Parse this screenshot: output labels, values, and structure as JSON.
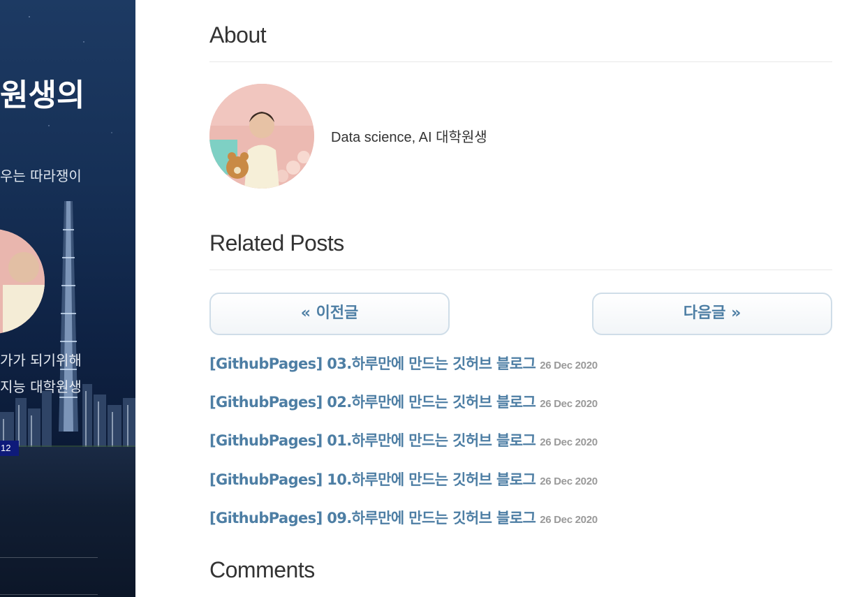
{
  "sidebar": {
    "title": "원생의",
    "subtitle": "우는 따라쟁이",
    "desc_line1": "가가 되기위해",
    "desc_line2": "지능 대학원생",
    "badge": "12"
  },
  "about": {
    "heading": "About",
    "text": "Data science, AI 대학원생"
  },
  "related": {
    "heading": "Related Posts",
    "prev_label": "« 이전글",
    "next_label": "다음글 »",
    "posts": [
      {
        "title": "[GithubPages] 03.하루만에 만드는 깃허브 블로그",
        "date": "26 Dec 2020"
      },
      {
        "title": "[GithubPages] 02.하루만에 만드는 깃허브 블로그",
        "date": "26 Dec 2020"
      },
      {
        "title": "[GithubPages] 01.하루만에 만드는 깃허브 블로그",
        "date": "26 Dec 2020"
      },
      {
        "title": "[GithubPages] 10.하루만에 만드는 깃허브 블로그",
        "date": "26 Dec 2020"
      },
      {
        "title": "[GithubPages] 09.하루만에 만드는 깃허브 블로그",
        "date": "26 Dec 2020"
      }
    ]
  },
  "comments": {
    "heading": "Comments"
  },
  "colors": {
    "link": "#4d7ea4",
    "heading": "#333333",
    "date": "#9a9a9a",
    "sidebar_bg": "#163056"
  }
}
